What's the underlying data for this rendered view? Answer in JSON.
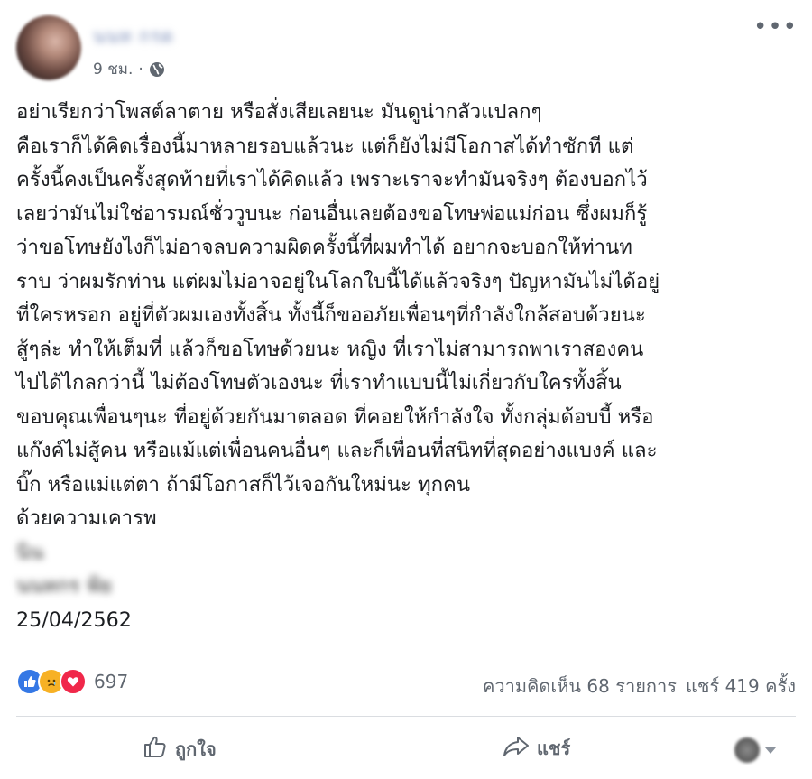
{
  "post": {
    "author_name": "นนท กรด",
    "timestamp": "9 ชม.",
    "separator": "·",
    "more_label": "•••",
    "body_lines": [
      "อย่าเรียกว่าโพสต์ลาตาย หรือสั่งเสียเลยนะ มันดูน่ากลัวแปลกๆ",
      "คือเราก็ได้คิดเรื่องนี้มาหลายรอบแล้วนะ แต่ก็ยังไม่มีโอกาสได้ทำซักที แต่",
      "ครั้งนี้คงเป็นครั้งสุดท้ายที่เราได้คิดแล้ว เพราะเราจะทำมันจริงๆ ต้องบอกไว้",
      "เลยว่ามันไม่ใช่อารมณ์ชั่ววูบนะ ก่อนอื่นเลยต้องขอโทษพ่อแม่ก่อน ซึ่งผมก็รู้",
      "ว่าขอโทษยังไงก็ไม่อาจลบความผิดครั้งนี้ที่ผมทำได้ อยากจะบอกให้ท่านท",
      "ราบ ว่าผมรักท่าน แต่ผมไม่อาจอยู่ในโลกใบนี้ได้แล้วจริงๆ ปัญหามันไม่ได้อยู่",
      "ที่ใครหรอก อยู่ที่ตัวผมเองทั้งสิ้น ทั้งนี้ก็ขออภัยเพื่อนๆที่กำลังใกล้สอบด้วยนะ",
      "สู้ๆล่ะ ทำให้เต็มที่ แล้วก็ขอโทษด้วยนะ หญิง ที่เราไม่สามารถพาเราสองคน",
      "ไปได้ไกลกว่านี้ ไม่ต้องโทษตัวเองนะ ที่เราทำแบบนี้ไม่เกี่ยวกับใครทั้งสิ้น",
      "ขอบคุณเพื่อนๆนะ ที่อยู่ด้วยกันมาตลอด ที่คอยให้กำลังใจ ทั้งกลุ่มด้อบบี้ หรือ",
      "แก๊งค์ไม่สู้คน หรือแม้แต่เพื่อนคนอื่นๆ และก็เพื่อนที่สนิทที่สุดอย่างแบงค์ และ",
      "บิ๊ก หรือแม่แต่ตา ถ้ามีโอกาสก็ไว้เจอกันใหม่นะ ทุกคน",
      "ด้วยความเคารพ"
    ],
    "signature_line_1": "นิน",
    "signature_line_2": "นนทกร ฟ้ย",
    "date": "25/04/2562"
  },
  "engagement": {
    "reaction_count": "697",
    "comments_text": "ความคิดเห็น 68 รายการ",
    "shares_text": "แชร์ 419 ครั้ง"
  },
  "actions": {
    "like_label": "ถูกใจ",
    "share_label": "แชร์"
  },
  "colors": {
    "like_blue": "#3578e5",
    "sad_yellow": "#f7b125",
    "love_red": "#f0284a",
    "meta_gray": "#606770"
  }
}
